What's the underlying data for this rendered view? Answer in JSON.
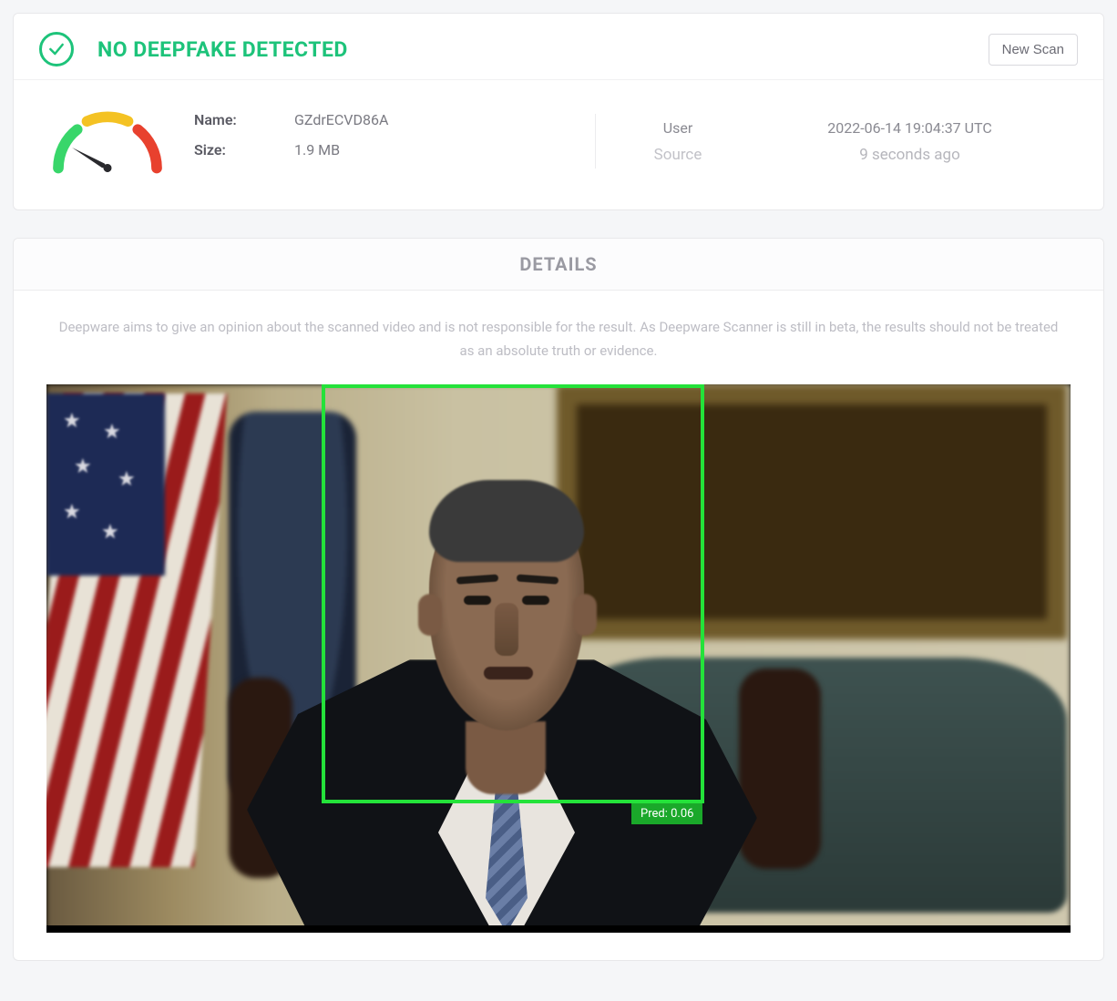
{
  "result": {
    "status_title": "NO DEEPFAKE DETECTED",
    "new_scan_label": "New Scan",
    "name_label": "Name:",
    "name_value": "GZdrECVD86A",
    "size_label": "Size:",
    "size_value": "1.9 MB",
    "origin_label": "User",
    "origin_value": "Source",
    "timestamp": "2022-06-14 19:04:37 UTC",
    "relative_time": "9 seconds ago"
  },
  "details": {
    "header": "DETAILS",
    "disclaimer": "Deepware aims to give an opinion about the scanned video and is not responsible for the result. As Deepware Scanner is still in beta, the results should not be treated as an absolute truth or evidence."
  },
  "detection": {
    "pred_label": "Pred: 0.06",
    "pred_value": 0.06
  },
  "colors": {
    "success": "#1dc37a",
    "box": "#24e23a"
  }
}
